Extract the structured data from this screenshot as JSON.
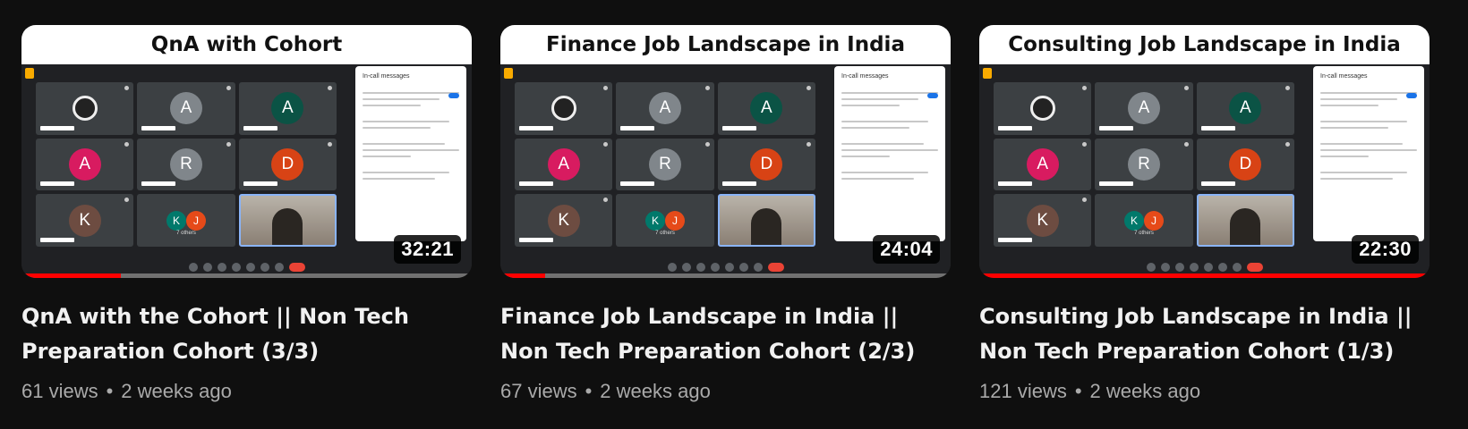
{
  "videos": [
    {
      "thumbnail_title": "QnA with Cohort",
      "duration": "32:21",
      "progress": 0.22,
      "title": "QnA with the Cohort || Non Tech Preparation Cohort (3/3)",
      "views": "61 views",
      "age": "2 weeks ago"
    },
    {
      "thumbnail_title": "Finance Job Landscape in India",
      "duration": "24:04",
      "progress": 0.1,
      "title": "Finance Job Landscape in India || Non Tech Preparation Cohort (2/3)",
      "views": "67 views",
      "age": "2 weeks ago"
    },
    {
      "thumbnail_title": "Consulting Job Landscape in India",
      "duration": "22:30",
      "progress": 1.0,
      "title": "Consulting Job Landscape in India || Non Tech Preparation Cohort (1/3)",
      "views": "121 views",
      "age": "2 weeks ago"
    }
  ],
  "separator": "•",
  "meet": {
    "tiles": [
      {
        "kind": "obs"
      },
      {
        "kind": "avatar",
        "letter": "A",
        "color": "#80868b"
      },
      {
        "kind": "avatar",
        "letter": "A",
        "color": "#0b5345"
      },
      {
        "kind": "avatar",
        "letter": "A",
        "color": "#d81b60"
      },
      {
        "kind": "avatar",
        "letter": "R",
        "color": "#80868b"
      },
      {
        "kind": "avatar",
        "letter": "D",
        "color": "#d84315"
      },
      {
        "kind": "avatar",
        "letter": "K",
        "color": "#6d4c41"
      },
      {
        "kind": "pair",
        "letters": [
          "K",
          "J"
        ],
        "colors": [
          "#00796b",
          "#e64a19"
        ],
        "label": "7 others"
      },
      {
        "kind": "cam"
      }
    ],
    "chat_title": "In-call messages"
  },
  "colors": {
    "progress": "#ff0000",
    "background": "#0f0f0f",
    "meta_text": "#aaaaaa"
  }
}
